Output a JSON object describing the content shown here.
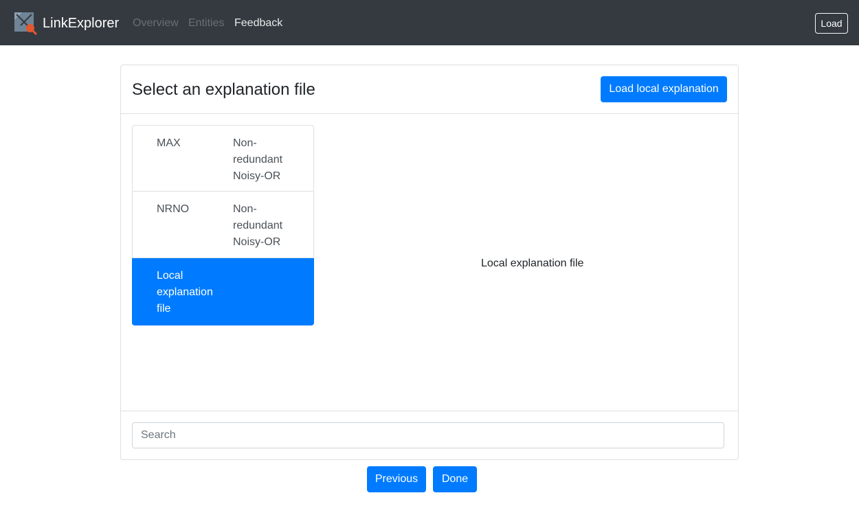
{
  "navbar": {
    "brand": "LinkExplorer",
    "logo_icon": "linkexplorer-logo-icon",
    "links": [
      {
        "label": "Overview"
      },
      {
        "label": "Entities"
      },
      {
        "label": "Feedback"
      }
    ],
    "load_label": "Load"
  },
  "card": {
    "title": "Select an explanation file",
    "load_local_label": "Load local explanation",
    "items": [
      {
        "name": "MAX",
        "description": "Non-redundant Noisy-OR",
        "active": false
      },
      {
        "name": "NRNO",
        "description": "Non-redundant Noisy-OR",
        "active": false
      },
      {
        "name": "Local explanation file",
        "description": "",
        "active": true
      }
    ],
    "content_label": "Local explanation file",
    "search": {
      "placeholder": "Search",
      "value": ""
    }
  },
  "footer_buttons": {
    "previous_label": "Previous",
    "done_label": "Done"
  },
  "colors": {
    "navbar_bg": "#343a40",
    "primary": "#007bff",
    "logo_accent": "#e4572e"
  }
}
